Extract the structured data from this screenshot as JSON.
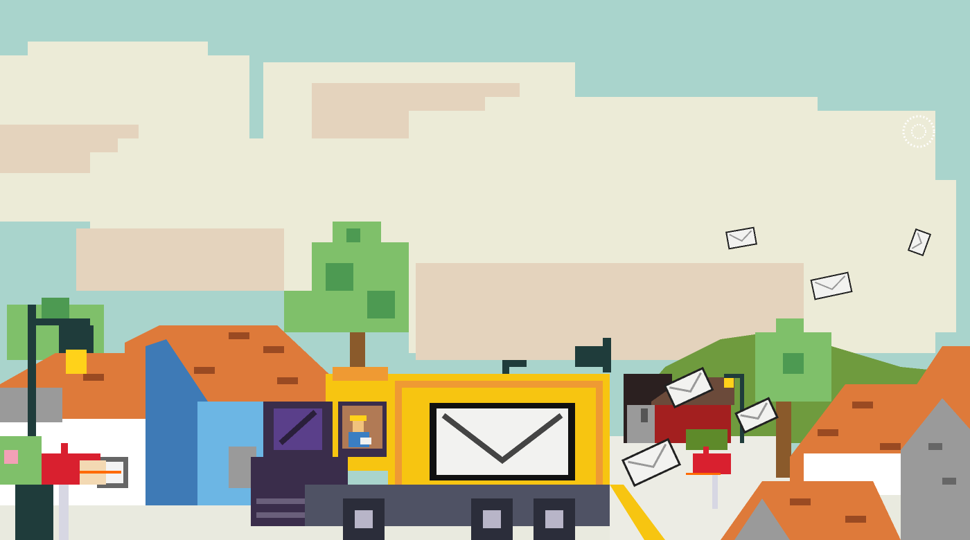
{
  "scene": {
    "type": "pixel-art game scene",
    "colors": {
      "sky": "#a9d4cc",
      "cloud": "#ecebd7",
      "cloud_shadow": "#e4d3bd",
      "roof": "#de7a3a",
      "roof_brick": "#9a4a22",
      "truck_body": "#f7c511",
      "truck_trim": "#ef9a33",
      "truck_cab_dark": "#3a2d4b",
      "truck_base": "#4f5264",
      "envelope": "#f2f2f0",
      "mailbox": "#d9202f",
      "tree_light": "#7fc06a",
      "tree_dark": "#4d9a52",
      "hill": "#6f9b3e",
      "wall_white": "#ffffff",
      "wall_blue": "#6cb6e4",
      "wall_grey": "#9a9a9a",
      "lamp_post": "#1f3c3b",
      "lamp_light": "#ffd21a"
    },
    "icons": [
      "mail-truck-icon",
      "mailman-icon",
      "envelope-icon",
      "mailbox-icon",
      "street-lamp-icon",
      "tree-icon",
      "house-icon",
      "sparkle-icon"
    ],
    "flying_envelopes": 7
  }
}
